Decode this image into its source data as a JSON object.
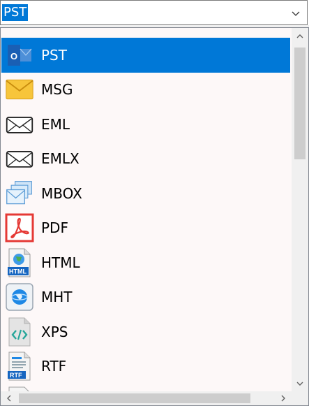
{
  "combo": {
    "selected": "PST"
  },
  "list": {
    "items": [
      {
        "label": "PST",
        "icon": "outlook-pst-icon",
        "selected": true
      },
      {
        "label": "MSG",
        "icon": "envelope-yellow-icon",
        "selected": false
      },
      {
        "label": "EML",
        "icon": "envelope-outline-icon",
        "selected": false
      },
      {
        "label": "EMLX",
        "icon": "envelope-outline-icon",
        "selected": false
      },
      {
        "label": "MBOX",
        "icon": "envelope-stack-icon",
        "selected": false
      },
      {
        "label": "PDF",
        "icon": "pdf-icon",
        "selected": false
      },
      {
        "label": "HTML",
        "icon": "html-file-icon",
        "selected": false
      },
      {
        "label": "MHT",
        "icon": "globe-web-icon",
        "selected": false
      },
      {
        "label": "XPS",
        "icon": "xps-file-icon",
        "selected": false
      },
      {
        "label": "RTF",
        "icon": "rtf-file-icon",
        "selected": false
      }
    ]
  },
  "colors": {
    "selection": "#0078d7",
    "list_bg": "#fdf8f8"
  }
}
